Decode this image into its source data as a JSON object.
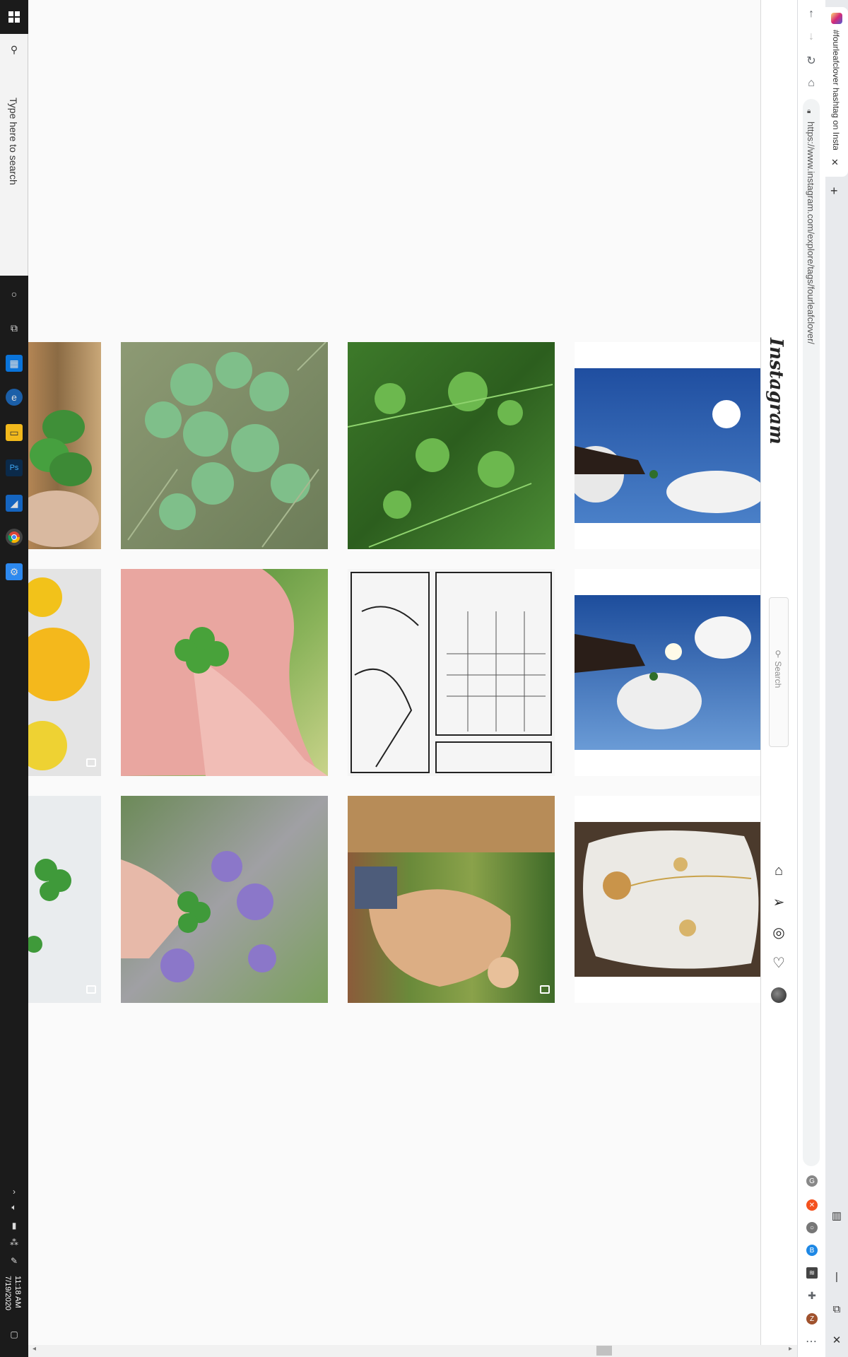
{
  "taskbar": {
    "search_placeholder": "Type here to search",
    "time": "11:18 AM",
    "date": "7/19/2020"
  },
  "browser": {
    "tab_title": "#fourleafclover hashtag on Insta",
    "url": "https://www.instagram.com/explore/tags/fourleafclover/",
    "extensions": [
      "g-icon",
      "x-icon",
      "o-icon",
      "b-icon",
      "r-icon",
      "puzzle-icon",
      "z-icon"
    ]
  },
  "instagram": {
    "logo": "Instagram",
    "search_placeholder": "Search"
  },
  "posts": [
    {
      "name": "clover-hand-wood",
      "multi": false
    },
    {
      "name": "clover-lawn",
      "multi": false
    },
    {
      "name": "clover-grass",
      "multi": false
    },
    {
      "name": "hand-sky-clover-1",
      "multi": false
    },
    {
      "name": "lemons",
      "multi": true
    },
    {
      "name": "fingers-clover",
      "multi": false
    },
    {
      "name": "comic-sketch",
      "multi": false
    },
    {
      "name": "hand-sky-clover-2",
      "multi": false
    },
    {
      "name": "clover-white",
      "multi": true
    },
    {
      "name": "clover-flowers",
      "multi": false
    },
    {
      "name": "person-field",
      "multi": true
    },
    {
      "name": "stone-jewelry",
      "multi": false
    }
  ]
}
